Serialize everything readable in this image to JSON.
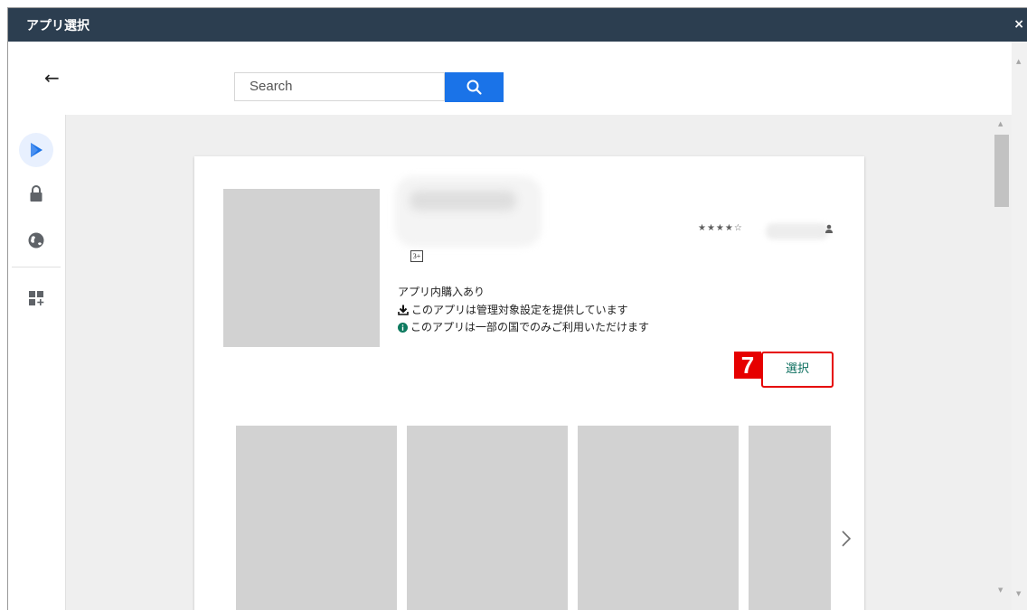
{
  "dialog": {
    "title": "アプリ選択",
    "close_glyph": "×"
  },
  "topbar": {
    "back_glyph": "←",
    "search": {
      "placeholder": "Search",
      "value": "",
      "button_icon": "search-icon"
    }
  },
  "nav_rail": {
    "items": [
      {
        "icon": "google-play-icon",
        "selected": true
      },
      {
        "icon": "lock-icon",
        "selected": false
      },
      {
        "icon": "globe-icon",
        "selected": false
      },
      {
        "icon": "add-web-app-icon",
        "selected": false
      }
    ]
  },
  "app_card": {
    "rating_stars": "★★★★☆",
    "content_rating": "3+",
    "in_app_purchases": "アプリ内購入あり",
    "managed_config": "このアプリは管理対象設定を提供しています",
    "country_limited": "このアプリは一部の国でのみご利用いただけます",
    "step_number": "7",
    "select_button": "選択",
    "screenshot_count": 4
  },
  "colors": {
    "titlebar": "#2c3e50",
    "accent_blue": "#1a73e8",
    "highlight_red": "#e60000",
    "select_text": "#0b6e5e",
    "info_green": "#0d7a5f",
    "placeholder_gray": "#d2d2d2"
  }
}
